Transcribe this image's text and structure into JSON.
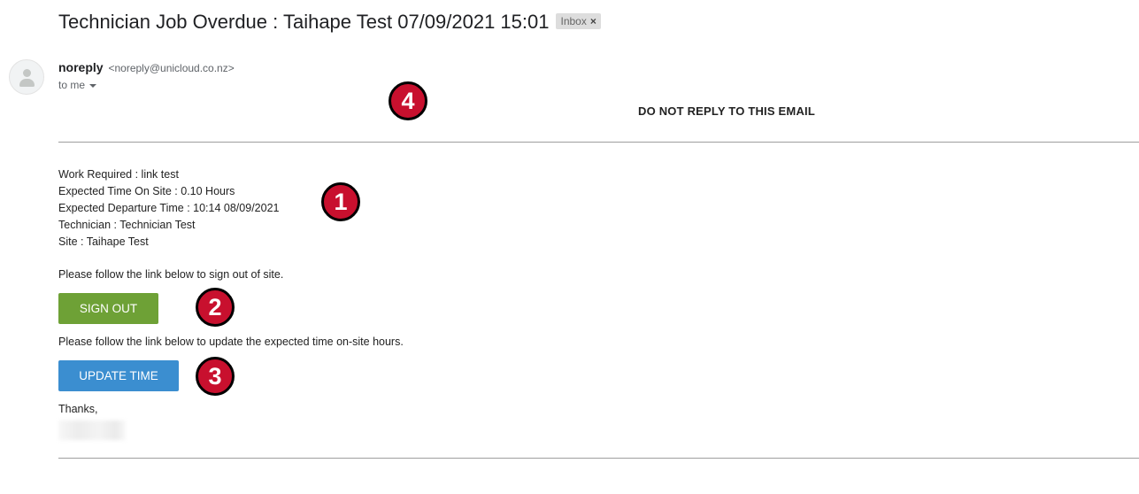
{
  "subject": "Technician Job Overdue : Taihape Test 07/09/2021 15:01",
  "label_chip": {
    "text": "Inbox",
    "close": "×"
  },
  "sender": {
    "name": "noreply",
    "email": "<noreply@unicloud.co.nz>",
    "to": "to me"
  },
  "markers": [
    "1",
    "2",
    "3",
    "4"
  ],
  "notice": "DO NOT REPLY TO THIS EMAIL",
  "details": [
    "Work Required : link test",
    "Expected Time On Site : 0.10 Hours",
    "Expected Departure Time : 10:14 08/09/2021",
    "Technician : Technician Test",
    "Site : Taihape Test"
  ],
  "sign_out_prompt": "Please follow the link below to sign out of site.",
  "sign_out_button": "SIGN OUT",
  "update_prompt": "Please follow the link below to update the expected time on-site hours.",
  "update_button": "UPDATE TIME",
  "closing": "Thanks,",
  "colors": {
    "sign_out_button": "#6ea136",
    "update_button": "#3b8ed0",
    "marker_fill": "#c8102e",
    "marker_border": "#000000"
  }
}
